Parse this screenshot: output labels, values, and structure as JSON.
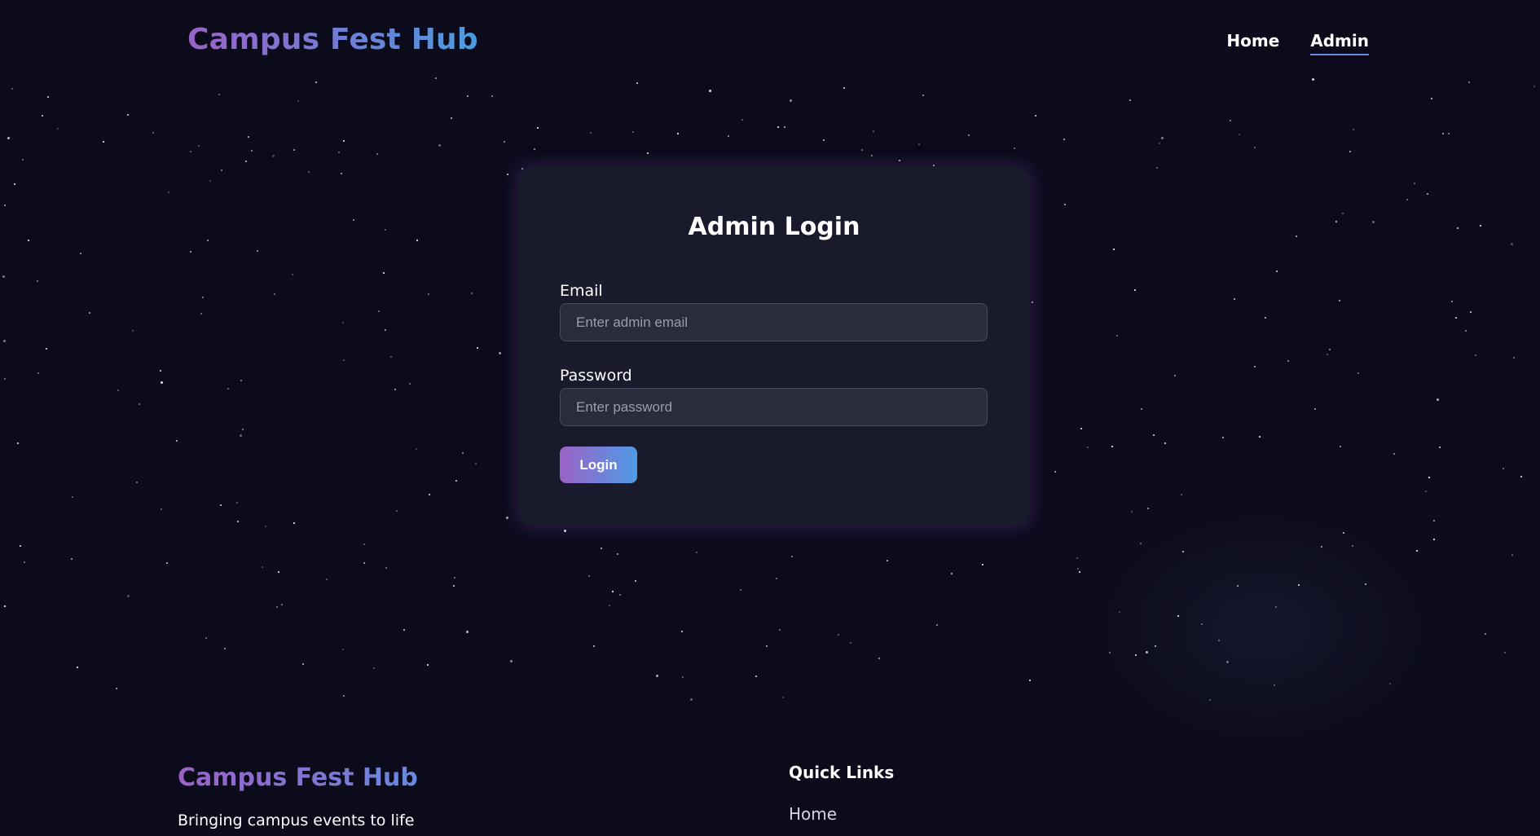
{
  "header": {
    "brand": "Campus Fest Hub",
    "nav": [
      {
        "label": "Home",
        "active": false
      },
      {
        "label": "Admin",
        "active": true
      }
    ]
  },
  "login_form": {
    "title": "Admin Login",
    "email_label": "Email",
    "email_placeholder": "Enter admin email",
    "email_value": "",
    "password_label": "Password",
    "password_placeholder": "Enter password",
    "password_value": "",
    "submit_label": "Login"
  },
  "footer": {
    "brand": "Campus Fest Hub",
    "tagline": "Bringing campus events to life",
    "quick_links_title": "Quick Links",
    "quick_links": [
      "Home"
    ]
  },
  "colors": {
    "background": "#0b0b1c",
    "card": "#191a2c",
    "accent_purple": "#9b62c6",
    "accent_blue": "#4f9be4"
  }
}
